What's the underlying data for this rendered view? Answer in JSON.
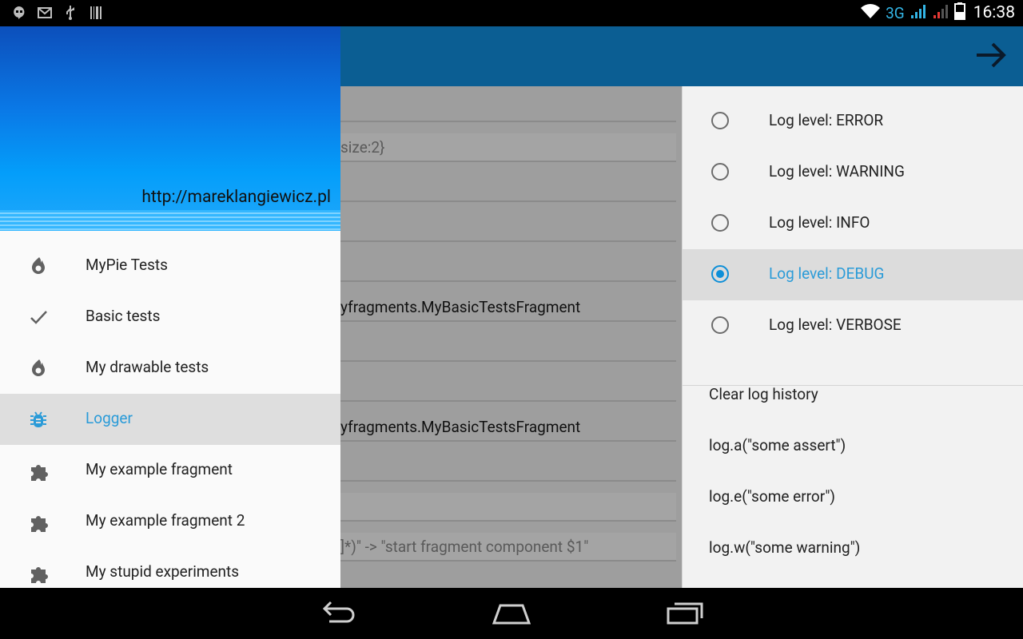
{
  "status_bar": {
    "network": "3G",
    "time": "16:38",
    "left_icons": [
      "hangouts-icon",
      "gmail-icon",
      "usb-icon",
      "barcode-icon"
    ]
  },
  "action_bar": {
    "forward_icon": "arrow-forward-icon"
  },
  "drawer": {
    "header_url": "http://mareklangiewicz.pl",
    "items": [
      {
        "label": "MyPie Tests",
        "icon": "flame-icon"
      },
      {
        "label": "Basic tests",
        "icon": "check-icon"
      },
      {
        "label": "My drawable tests",
        "icon": "flame-icon"
      },
      {
        "label": "Logger",
        "icon": "bug-icon",
        "selected": true
      },
      {
        "label": "My example fragment",
        "icon": "puzzle-icon"
      },
      {
        "label": "My example fragment 2",
        "icon": "puzzle-icon"
      },
      {
        "label": "My stupid experiments",
        "icon": "puzzle-icon"
      }
    ]
  },
  "main_fragments": [
    {
      "text": "size:2}"
    },
    {
      "text": "yfragments.MyBasicTestsFragment"
    },
    {
      "text": "yfragments.MyBasicTestsFragment"
    },
    {
      "text": "]*)\" -> \"start fragment component $1\""
    }
  ],
  "right_pane": {
    "log_levels": [
      {
        "label": "Log level: ERROR",
        "selected": false
      },
      {
        "label": "Log level: WARNING",
        "selected": false
      },
      {
        "label": "Log level: INFO",
        "selected": false
      },
      {
        "label": "Log level: DEBUG",
        "selected": true
      },
      {
        "label": "Log level: VERBOSE",
        "selected": false
      }
    ],
    "actions": [
      "Clear log history",
      "log.a(\"some assert\")",
      "log.e(\"some error\")",
      "log.w(\"some warning\")"
    ]
  },
  "colors": {
    "accent": "#33b5e5",
    "action_bar": "#0b5e93",
    "selected_text": "#2a9bd8"
  }
}
